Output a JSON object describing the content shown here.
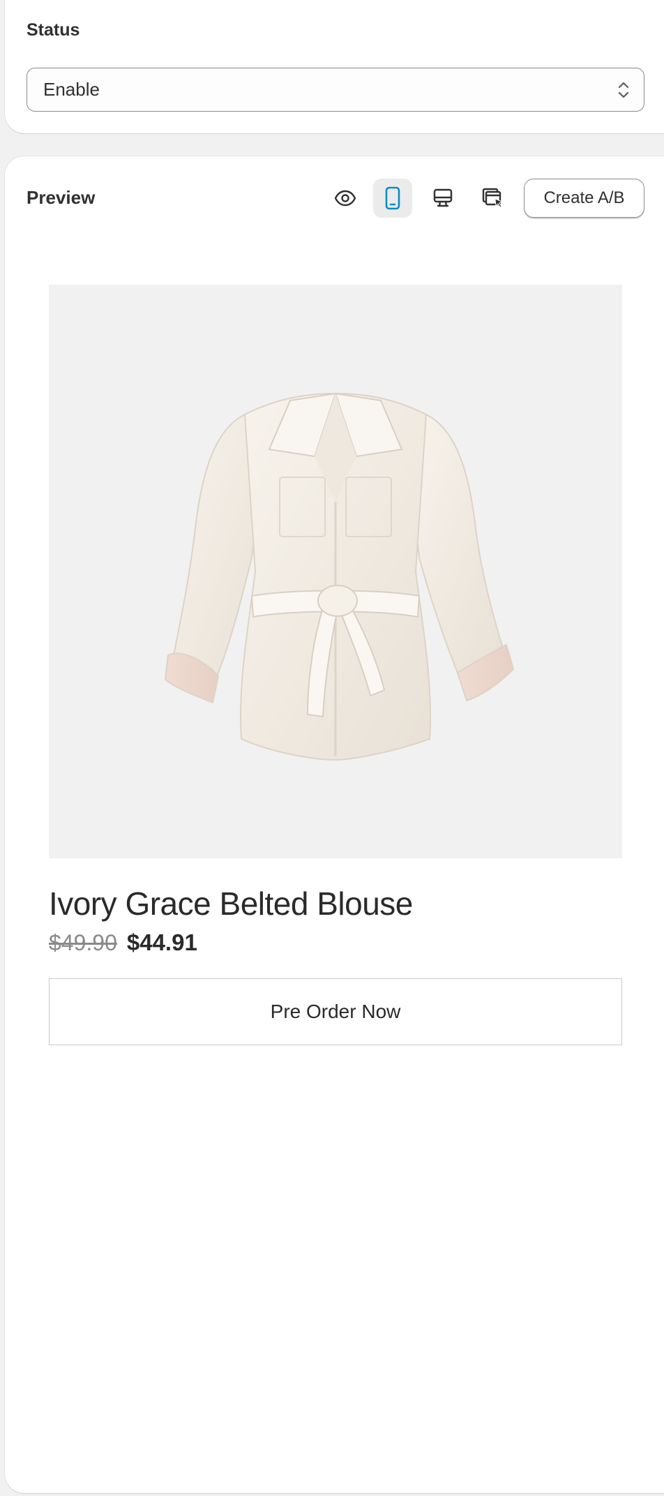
{
  "status": {
    "label": "Status",
    "selected": "Enable"
  },
  "preview": {
    "title": "Preview",
    "icons": [
      "eye-icon",
      "mobile-icon",
      "desktop-icon",
      "fullscreen-icon"
    ],
    "active_view": "mobile",
    "ab_button_label": "Create A/B",
    "accent_color": "#0a8ec3"
  },
  "product": {
    "name": "Ivory Grace Belted Blouse",
    "compare_price": "$49.90",
    "price": "$44.91",
    "cta_label": "Pre Order Now"
  }
}
